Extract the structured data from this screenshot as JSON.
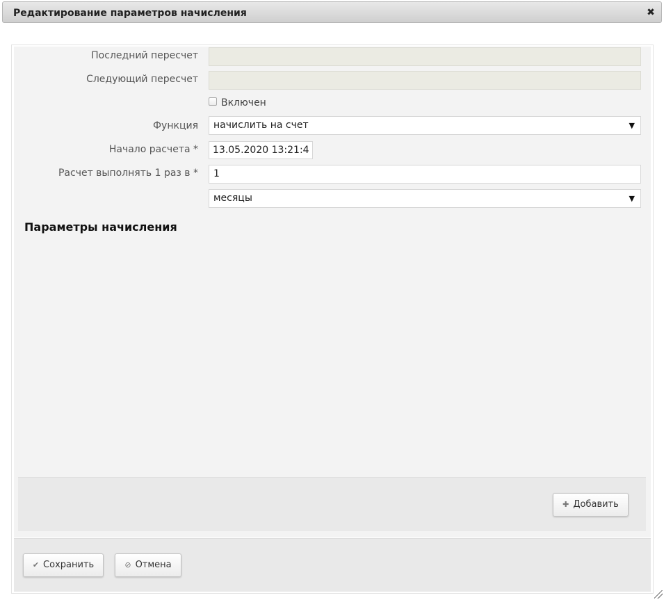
{
  "dialog": {
    "title": "Редактирование параметров начисления",
    "close_glyph": "✖",
    "close_icon": "close-icon"
  },
  "form": {
    "last_recalc_label": "Последний пересчет",
    "last_recalc_value": "",
    "next_recalc_label": "Следующий пересчет",
    "next_recalc_value": "",
    "enabled_label": "Включен",
    "enabled_checked": false,
    "function_label": "Функция",
    "function_value": "начислить на счет",
    "start_label": "Начало расчета *",
    "start_value": "13.05.2020 13:21:4",
    "interval_label": "Расчет выполнять 1 раз в *",
    "interval_value": "1",
    "unit_value": "месяцы",
    "dropdown_glyph": "▼"
  },
  "params": {
    "title": "Параметры начисления",
    "add_label": "Добавить",
    "add_glyph": "✚",
    "add_icon": "plus-icon"
  },
  "footer": {
    "save_label": "Сохранить",
    "save_glyph": "✔",
    "save_icon": "check-icon",
    "cancel_label": "Отмена",
    "cancel_glyph": "⊘",
    "cancel_icon": "cancel-icon"
  },
  "colors": {
    "form_background": "#f3f3f3",
    "readonly_field": "#ebebe3",
    "footer_background": "#e9e9e9"
  }
}
